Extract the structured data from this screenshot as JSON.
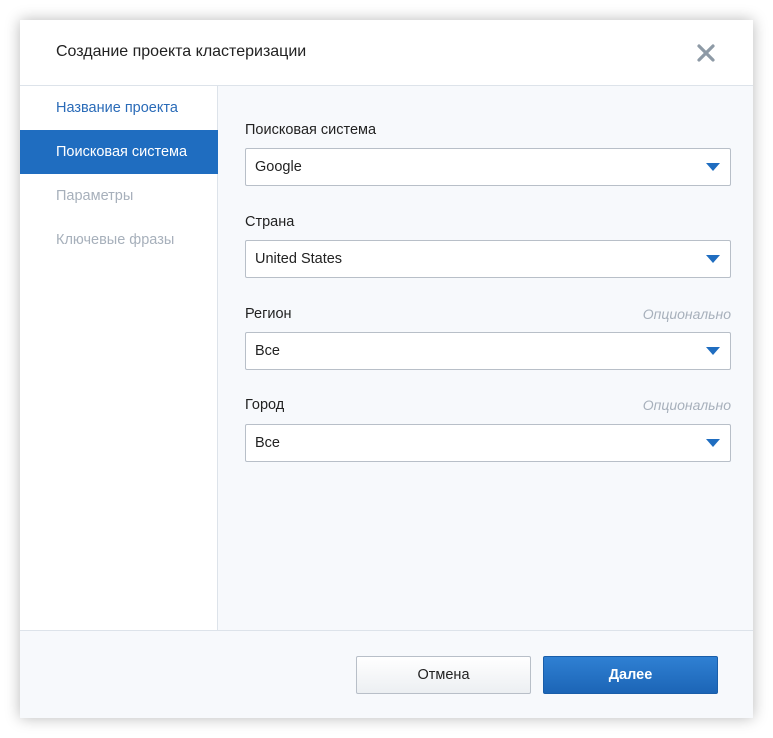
{
  "dialog": {
    "title": "Создание проекта кластеризации"
  },
  "sidebar": {
    "items": [
      {
        "label": "Название проекта",
        "state": "done"
      },
      {
        "label": "Поисковая система",
        "state": "active"
      },
      {
        "label": "Параметры",
        "state": "pending"
      },
      {
        "label": "Ключевые фразы",
        "state": "pending"
      }
    ]
  },
  "form": {
    "search_engine": {
      "label": "Поисковая система",
      "value": "Google"
    },
    "country": {
      "label": "Страна",
      "value": "United States"
    },
    "region": {
      "label": "Регион",
      "optional": "Опционально",
      "value": "Все"
    },
    "city": {
      "label": "Город",
      "optional": "Опционально",
      "value": "Все"
    }
  },
  "footer": {
    "cancel_label": "Отмена",
    "next_label": "Далее"
  },
  "colors": {
    "accent": "#1f6dc0",
    "link": "#2a6bb8",
    "muted": "#a7b0bb"
  }
}
